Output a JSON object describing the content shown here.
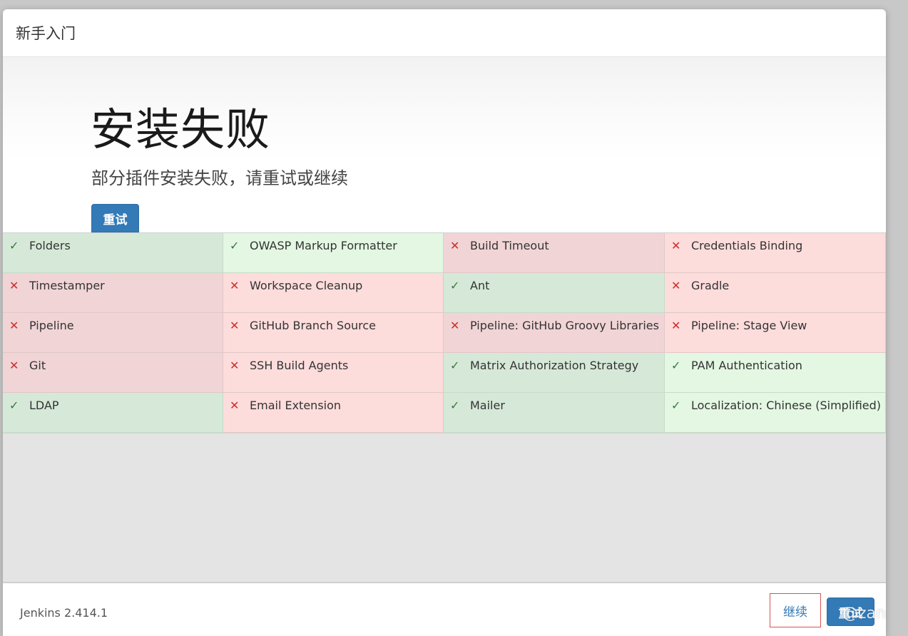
{
  "header": {
    "title": "新手入门"
  },
  "hero": {
    "title": "安装失败",
    "subtitle": "部分插件安装失败，请重试或继续",
    "retry_label": "重试"
  },
  "plugins": [
    {
      "name": "Folders",
      "status": "success",
      "shade": "dark"
    },
    {
      "name": "OWASP Markup Formatter",
      "status": "success",
      "shade": "light"
    },
    {
      "name": "Build Timeout",
      "status": "fail",
      "shade": "dark"
    },
    {
      "name": "Credentials Binding",
      "status": "fail",
      "shade": "light"
    },
    {
      "name": "Timestamper",
      "status": "fail",
      "shade": "dark"
    },
    {
      "name": "Workspace Cleanup",
      "status": "fail",
      "shade": "light"
    },
    {
      "name": "Ant",
      "status": "success",
      "shade": "dark"
    },
    {
      "name": "Gradle",
      "status": "fail",
      "shade": "light"
    },
    {
      "name": "Pipeline",
      "status": "fail",
      "shade": "dark"
    },
    {
      "name": "GitHub Branch Source",
      "status": "fail",
      "shade": "light"
    },
    {
      "name": "Pipeline: GitHub Groovy Libraries",
      "status": "fail",
      "shade": "dark"
    },
    {
      "name": "Pipeline: Stage View",
      "status": "fail",
      "shade": "light"
    },
    {
      "name": "Git",
      "status": "fail",
      "shade": "dark"
    },
    {
      "name": "SSH Build Agents",
      "status": "fail",
      "shade": "light"
    },
    {
      "name": "Matrix Authorization Strategy",
      "status": "success",
      "shade": "dark"
    },
    {
      "name": "PAM Authentication",
      "status": "success",
      "shade": "light"
    },
    {
      "name": "LDAP",
      "status": "success",
      "shade": "dark"
    },
    {
      "name": "Email Extension",
      "status": "fail",
      "shade": "light"
    },
    {
      "name": "Mailer",
      "status": "success",
      "shade": "dark"
    },
    {
      "name": "Localization: Chinese (Simplified)",
      "status": "success",
      "shade": "light"
    }
  ],
  "colors": {
    "success_dark": "#d6e9d8",
    "success_light": "#e3f7e3",
    "fail_dark": "#f1d4d6",
    "fail_light": "#fddcdc",
    "primary": "#337ab7"
  },
  "footer": {
    "version": "Jenkins 2.414.1",
    "continue_label": "继续",
    "retry_label": "重试"
  },
  "watermark": "@zan"
}
